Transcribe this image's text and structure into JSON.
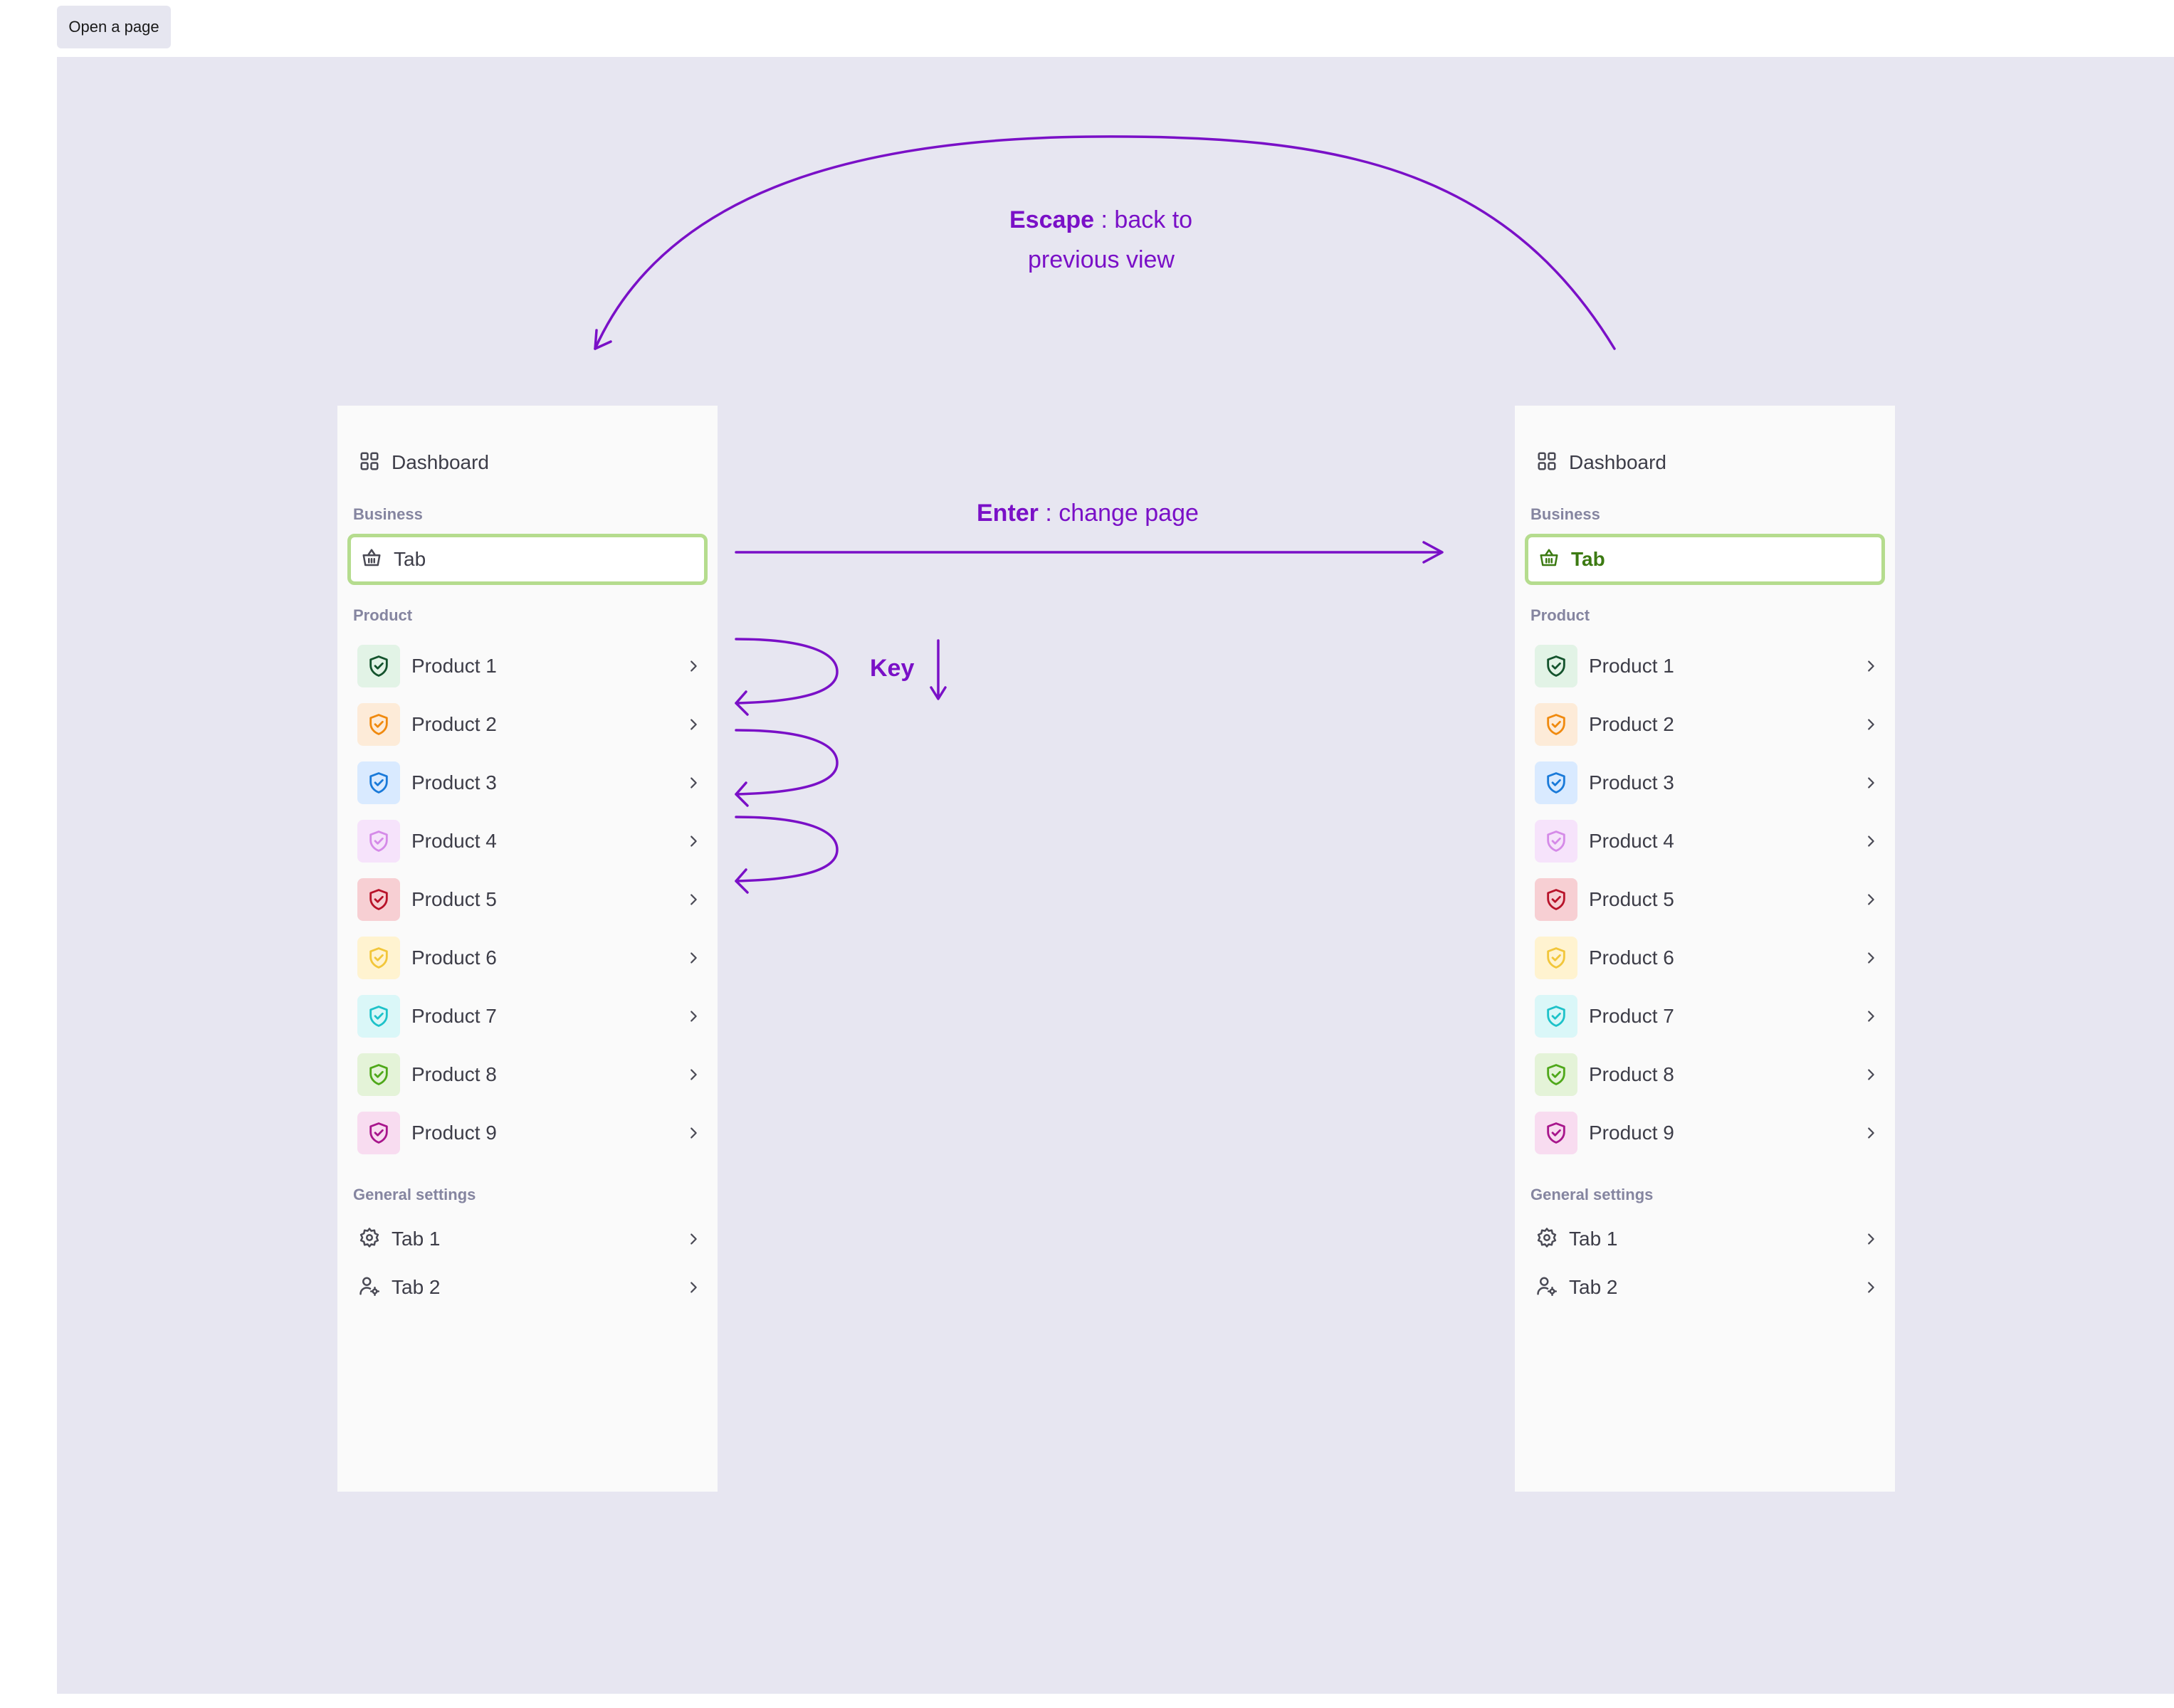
{
  "toolbar": {
    "open_page_label": "Open a page"
  },
  "annotations": {
    "escape_key": "Escape",
    "escape_text": " : back to",
    "escape_text_2": "previous view",
    "enter_key": "Enter",
    "enter_text": " : change page",
    "key_label": "Key"
  },
  "colors": {
    "canvas_bg": "#e7e6f1",
    "annotation": "#7a10c7",
    "focus_border": "#b5dc8e",
    "active_text": "#3c7a12"
  },
  "sidebars": [
    {
      "state": "focused",
      "dashboard_label": "Dashboard",
      "business_heading": "Business",
      "business_tab_label": "Tab",
      "product_heading": "Product",
      "products": [
        {
          "label": "Product 1",
          "icon": "shield-check-icon",
          "fg": "#14532d",
          "bg": "#e2f3e6"
        },
        {
          "label": "Product 2",
          "icon": "shield-check-icon",
          "fg": "#f08a0f",
          "bg": "#fdebd8"
        },
        {
          "label": "Product 3",
          "icon": "shield-check-icon",
          "fg": "#1a7ad9",
          "bg": "#d9eaff"
        },
        {
          "label": "Product 4",
          "icon": "shield-check-icon",
          "fg": "#d58ae8",
          "bg": "#f6e3fb"
        },
        {
          "label": "Product 5",
          "icon": "shield-check-icon",
          "fg": "#b8132a",
          "bg": "#f7cfd3"
        },
        {
          "label": "Product 6",
          "icon": "shield-check-icon",
          "fg": "#f2c63a",
          "bg": "#fff3d0"
        },
        {
          "label": "Product 7",
          "icon": "shield-check-icon",
          "fg": "#1ec2c9",
          "bg": "#daf7f8"
        },
        {
          "label": "Product 8",
          "icon": "shield-check-icon",
          "fg": "#4fa81a",
          "bg": "#e4f3d8"
        },
        {
          "label": "Product 9",
          "icon": "shield-check-icon",
          "fg": "#a8168c",
          "bg": "#f8dcf0"
        }
      ],
      "settings_heading": "General settings",
      "settings": [
        {
          "label": "Tab 1",
          "icon": "gear-icon"
        },
        {
          "label": "Tab 2",
          "icon": "user-gear-icon"
        }
      ]
    },
    {
      "state": "active",
      "dashboard_label": "Dashboard",
      "business_heading": "Business",
      "business_tab_label": "Tab",
      "product_heading": "Product",
      "products": [
        {
          "label": "Product 1",
          "icon": "shield-check-icon",
          "fg": "#14532d",
          "bg": "#e2f3e6"
        },
        {
          "label": "Product 2",
          "icon": "shield-check-icon",
          "fg": "#f08a0f",
          "bg": "#fdebd8"
        },
        {
          "label": "Product 3",
          "icon": "shield-check-icon",
          "fg": "#1a7ad9",
          "bg": "#d9eaff"
        },
        {
          "label": "Product 4",
          "icon": "shield-check-icon",
          "fg": "#d58ae8",
          "bg": "#f6e3fb"
        },
        {
          "label": "Product 5",
          "icon": "shield-check-icon",
          "fg": "#b8132a",
          "bg": "#f7cfd3"
        },
        {
          "label": "Product 6",
          "icon": "shield-check-icon",
          "fg": "#f2c63a",
          "bg": "#fff3d0"
        },
        {
          "label": "Product 7",
          "icon": "shield-check-icon",
          "fg": "#1ec2c9",
          "bg": "#daf7f8"
        },
        {
          "label": "Product 8",
          "icon": "shield-check-icon",
          "fg": "#4fa81a",
          "bg": "#e4f3d8"
        },
        {
          "label": "Product 9",
          "icon": "shield-check-icon",
          "fg": "#a8168c",
          "bg": "#f8dcf0"
        }
      ],
      "settings_heading": "General settings",
      "settings": [
        {
          "label": "Tab 1",
          "icon": "gear-icon"
        },
        {
          "label": "Tab 2",
          "icon": "user-gear-icon"
        }
      ]
    }
  ]
}
